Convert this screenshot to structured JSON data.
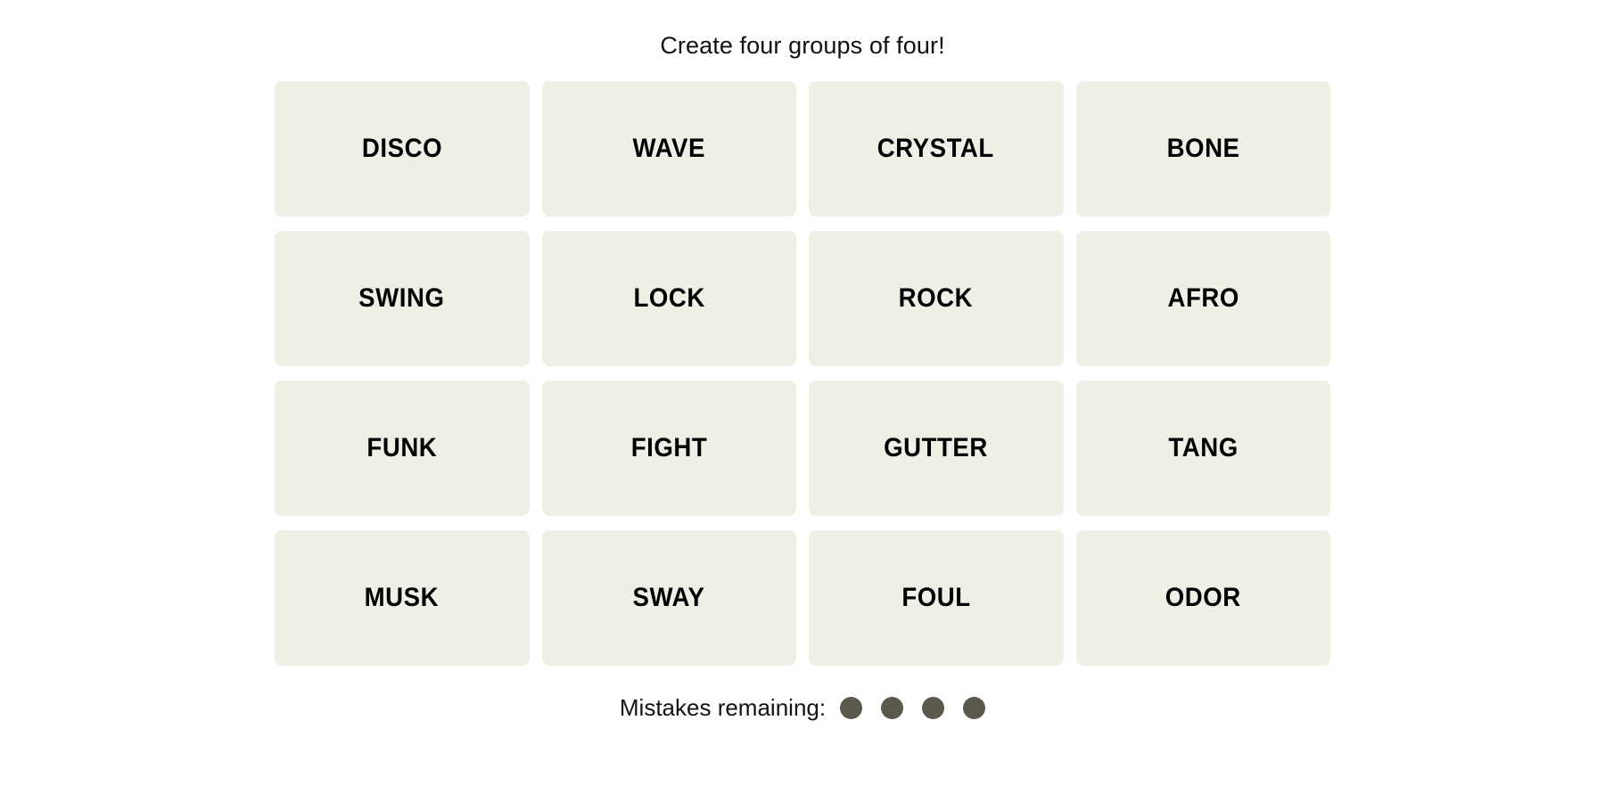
{
  "page": {
    "background_color": "#ffffff"
  },
  "instruction": {
    "text": "Create four groups of four!",
    "color": "#121212"
  },
  "board": {
    "rows": 4,
    "columns": 4,
    "tile_color": "#efefe6",
    "tile_text_color": "#000000",
    "tiles": [
      {
        "label": "DISCO",
        "row": 1,
        "col": 1,
        "selected": false
      },
      {
        "label": "WAVE",
        "row": 1,
        "col": 2,
        "selected": false
      },
      {
        "label": "CRYSTAL",
        "row": 1,
        "col": 3,
        "selected": false
      },
      {
        "label": "BONE",
        "row": 1,
        "col": 4,
        "selected": false
      },
      {
        "label": "SWING",
        "row": 2,
        "col": 1,
        "selected": false
      },
      {
        "label": "LOCK",
        "row": 2,
        "col": 2,
        "selected": false
      },
      {
        "label": "ROCK",
        "row": 2,
        "col": 3,
        "selected": false
      },
      {
        "label": "AFRO",
        "row": 2,
        "col": 4,
        "selected": false
      },
      {
        "label": "FUNK",
        "row": 3,
        "col": 1,
        "selected": false
      },
      {
        "label": "FIGHT",
        "row": 3,
        "col": 2,
        "selected": false
      },
      {
        "label": "GUTTER",
        "row": 3,
        "col": 3,
        "selected": false
      },
      {
        "label": "TANG",
        "row": 3,
        "col": 4,
        "selected": false
      },
      {
        "label": "MUSK",
        "row": 4,
        "col": 1,
        "selected": false
      },
      {
        "label": "SWAY",
        "row": 4,
        "col": 2,
        "selected": false
      },
      {
        "label": "FOUL",
        "row": 4,
        "col": 3,
        "selected": false
      },
      {
        "label": "ODOR",
        "row": 4,
        "col": 4,
        "selected": false
      }
    ]
  },
  "mistakes": {
    "label": "Mistakes remaining:",
    "remaining": 4,
    "dot_color": "#5a594c",
    "dots": [
      {
        "filled": true
      },
      {
        "filled": true
      },
      {
        "filled": true
      },
      {
        "filled": true
      }
    ]
  }
}
